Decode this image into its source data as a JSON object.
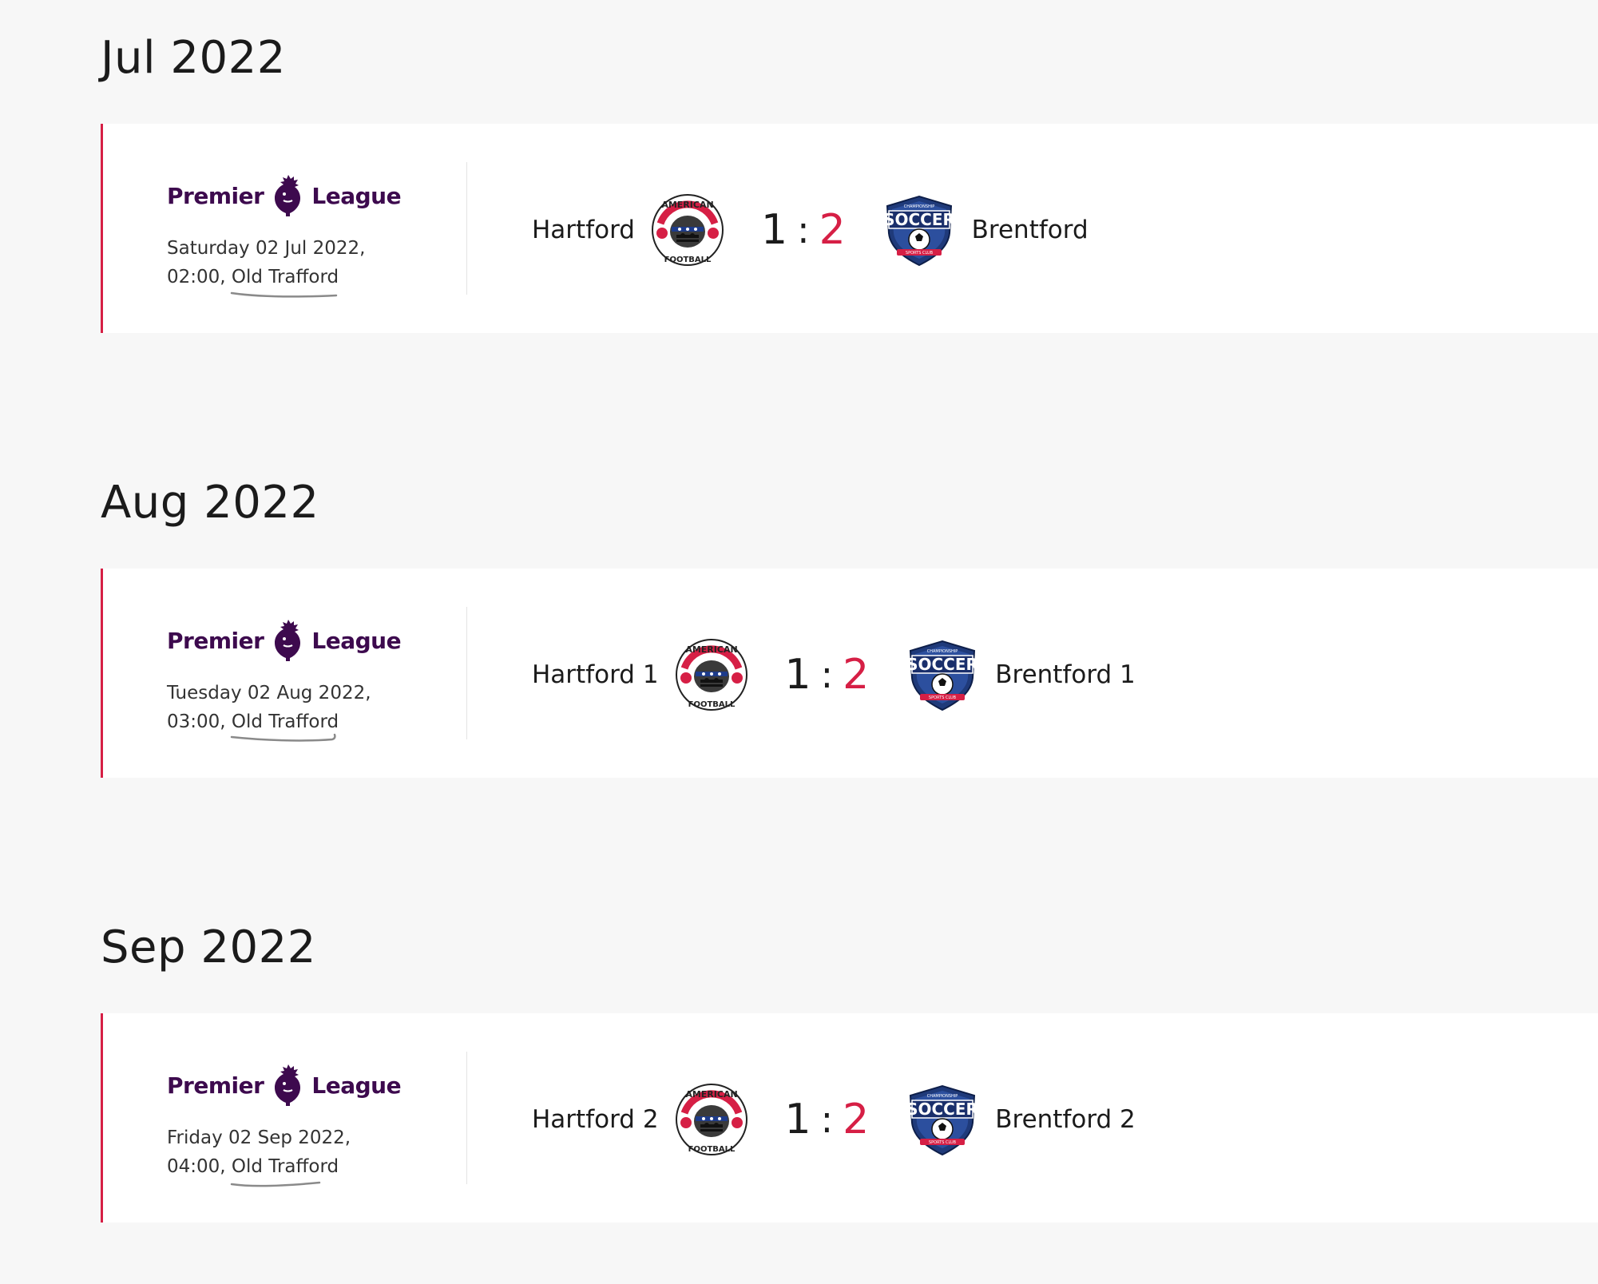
{
  "colors": {
    "page_background": "#f7f7f7",
    "card_background": "#ffffff",
    "accent_red": "#d61f45",
    "league_purple": "#3d0a4e",
    "text_dark": "#1b1b1b"
  },
  "league": {
    "word_left": "Premier",
    "word_right": "League",
    "icon": "premier-league-lion-icon"
  },
  "months": [
    {
      "heading": "Jul 2022",
      "match": {
        "date_line": "Saturday 02 Jul 2022,",
        "time": "02:00,",
        "venue": "Old Trafford",
        "home_team": "Hartford",
        "away_team": "Brentford",
        "home_score": "1",
        "separator": ":",
        "away_score": "2",
        "home_crest": "american-football-crest-icon",
        "away_crest": "soccer-sports-club-crest-icon"
      }
    },
    {
      "heading": "Aug 2022",
      "match": {
        "date_line": "Tuesday 02 Aug 2022,",
        "time": "03:00,",
        "venue": "Old Trafford",
        "home_team": "Hartford 1",
        "away_team": "Brentford 1",
        "home_score": "1",
        "separator": ":",
        "away_score": "2",
        "home_crest": "american-football-crest-icon",
        "away_crest": "soccer-sports-club-crest-icon"
      }
    },
    {
      "heading": "Sep 2022",
      "match": {
        "date_line": "Friday 02 Sep 2022,",
        "time": "04:00,",
        "venue": "Old Trafford",
        "home_team": "Hartford 2",
        "away_team": "Brentford 2",
        "home_score": "1",
        "separator": ":",
        "away_score": "2",
        "home_crest": "american-football-crest-icon",
        "away_crest": "soccer-sports-club-crest-icon"
      }
    }
  ]
}
